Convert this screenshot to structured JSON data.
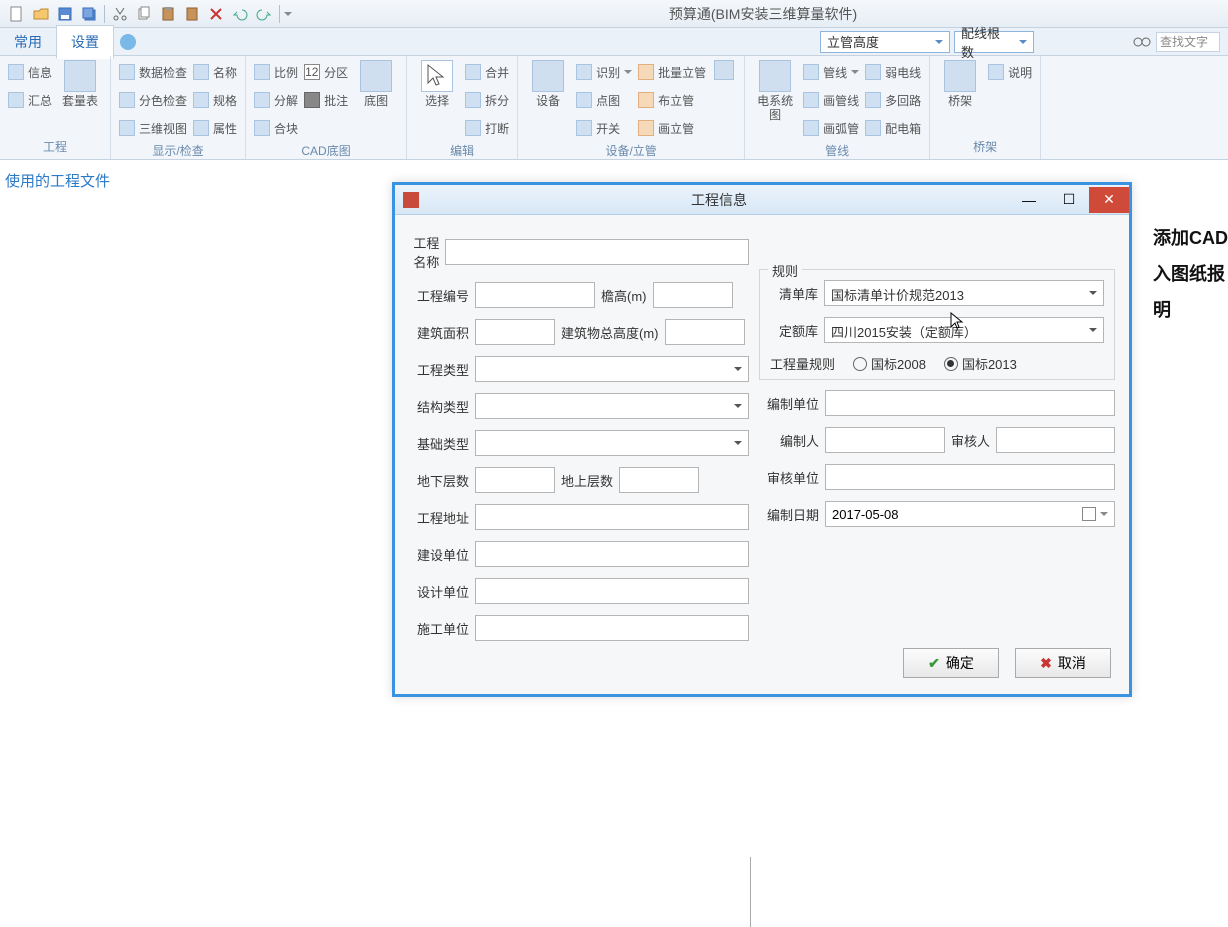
{
  "app_title": "预算通(BIM安装三维算量软件)",
  "qat": [
    "new",
    "open",
    "save",
    "saveall",
    "cut",
    "copy",
    "paste",
    "paste2",
    "delete",
    "undo",
    "redo"
  ],
  "tabs": {
    "t1": "常用",
    "t2": "设置"
  },
  "header_dd": {
    "d1": "立管高度",
    "d2": "配线根数",
    "find_ph": "查找文字"
  },
  "ribbon": {
    "g1": {
      "label": "工程",
      "b1": "信息",
      "b2": "汇总",
      "b3": "套量表"
    },
    "g2": {
      "label": "显示/检查",
      "s1": "数据检查",
      "s2": "分色检查",
      "s3": "三维视图",
      "s4": "名称",
      "s5": "规格",
      "s6": "属性"
    },
    "g3": {
      "label": "CAD底图",
      "s1": "比例",
      "s2": "分解",
      "s3": "合块",
      "s4": "分区",
      "s5": "批注",
      "b1": "底图"
    },
    "g4": {
      "label": "编辑",
      "b1": "选择",
      "s1": "合并",
      "s2": "拆分",
      "s3": "打断"
    },
    "g5": {
      "label": "设备/立管",
      "b1": "设备",
      "s1": "识别",
      "s2": "点图",
      "s3": "开关",
      "c1": "批量立管",
      "c2": "布立管",
      "c3": "画立管"
    },
    "g6": {
      "label": "管线",
      "b1": "电系统图",
      "s1": "管线",
      "s2": "画管线",
      "s3": "画弧管",
      "s4": "弱电线",
      "s5": "多回路",
      "s6": "配电箱"
    },
    "g7": {
      "label": "桥架",
      "b1": "桥架",
      "s1": "说明"
    }
  },
  "recent_files": "使用的工程文件",
  "side_text": {
    "l1": "添加CAD",
    "l2": "入图纸报",
    "l3": "明"
  },
  "dialog": {
    "title": "工程信息",
    "labels": {
      "name": "工程名称",
      "no": "工程编号",
      "eaves": "檐高(m)",
      "area": "建筑面积",
      "totalh": "建筑物总高度(m)",
      "ptype": "工程类型",
      "stype": "结构类型",
      "ftype": "基础类型",
      "below": "地下层数",
      "above": "地上层数",
      "addr": "工程地址",
      "build_unit": "建设单位",
      "design_unit": "设计单位",
      "const_unit": "施工单位",
      "rule": "规则",
      "listlib": "清单库",
      "quotalib": "定额库",
      "qrule": "工程量规则",
      "gb2008": "国标2008",
      "gb2013": "国标2013",
      "comp_unit": "编制单位",
      "compiler": "编制人",
      "reviewer": "审核人",
      "rev_unit": "审核单位",
      "comp_date": "编制日期"
    },
    "values": {
      "listlib": "国标清单计价规范2013",
      "quotalib": "四川2015安装（定额库）",
      "comp_date": "2017-05-08"
    },
    "buttons": {
      "ok": "确定",
      "cancel": "取消"
    }
  }
}
